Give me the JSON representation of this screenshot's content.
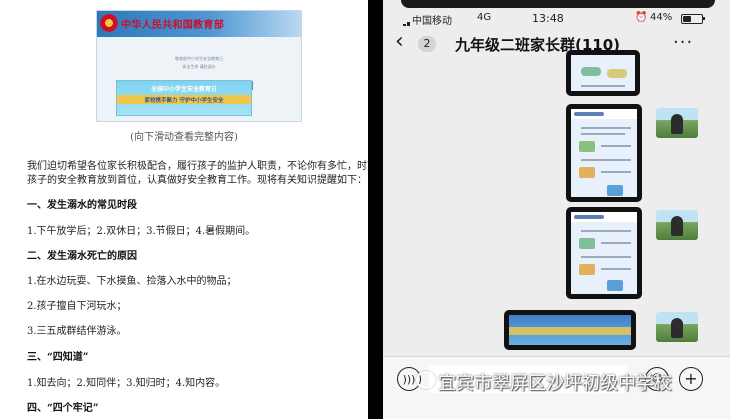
{
  "document": {
    "ministry_title": "中华人民共和国教育部",
    "ministry_subtitle": "教育部中小学生安全教育日",
    "ministry_subtitle2": "安全生命 谨防溺水",
    "safety_banner_title": "全国中小学生安全教育日",
    "safety_banner_slogan": "家校携手聚力 守护中小学生安全",
    "caption": "(向下滑动查看完整内容)",
    "intro_line1": "我们迫切希望各位家长积极配合，履行孩子的监护人职责，不论你有多忙，时刻把",
    "intro_line2": "孩子的安全教育放到首位，认真做好安全教育工作。现将有关知识提醒如下：",
    "section1_heading": "一、发生溺水的常见时段",
    "section1_text": "1.下午放学后；2.双休日；3.节假日；4.暑假期间。",
    "section2_heading": "二、发生溺水死亡的原因",
    "section2_item1": "1.在水边玩耍、下水摸鱼、捡落入水中的物品；",
    "section2_item2": "2.孩子擅自下河玩水；",
    "section2_item3": "3.三五成群结伴游泳。",
    "section3_heading": "三、“四知道”",
    "section3_text": "1.知去向；2.知同伴；3.知归时；4.知内容。",
    "section4_heading": "四、“四个牢记”"
  },
  "phone": {
    "status": {
      "carrier": "中国移动",
      "network": "4G",
      "time": "13:48",
      "alarm_icon": "alarm-icon",
      "battery": "44%",
      "battery_level": 0.44
    },
    "nav": {
      "back_icon": "‹",
      "unread_count": "2",
      "title": "九年级二班家长群(110)",
      "more_icon": "···"
    },
    "input": {
      "voice_icon": "voice-icon",
      "emoji_icon": "emoji-icon",
      "plus_icon": "plus-icon"
    }
  },
  "watermark": "宜宾市翠屏区沙坪初级中学校",
  "colors": {
    "ministry_red": "#c8102e",
    "banner_blue": "#2f78b8",
    "chat_bg": "#ededed"
  }
}
